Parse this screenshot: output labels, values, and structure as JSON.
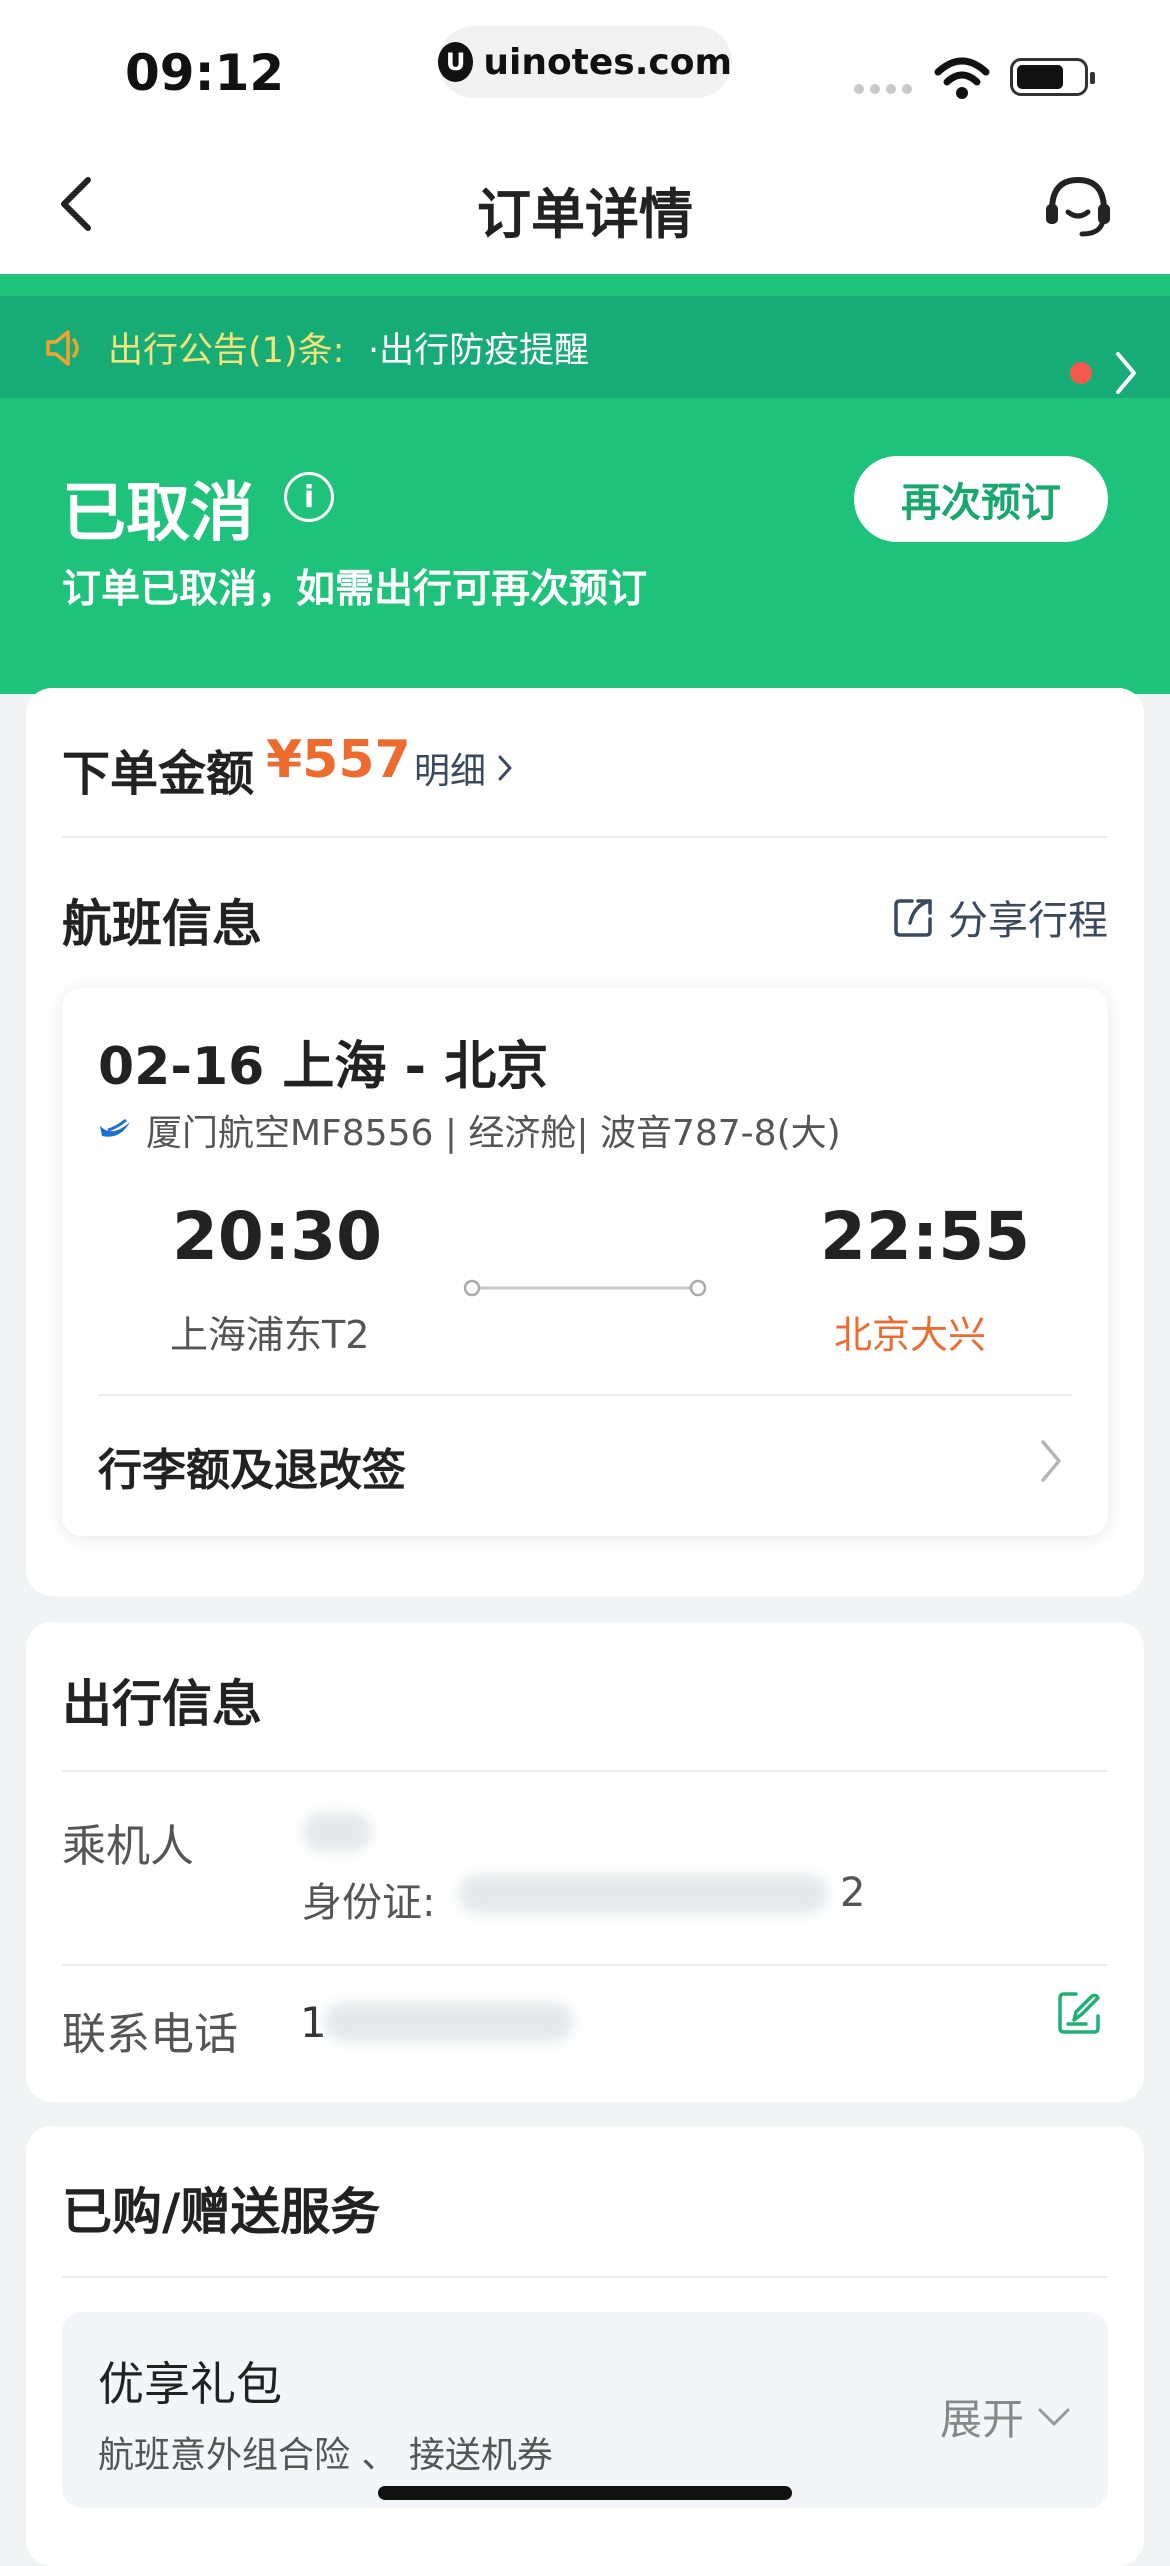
{
  "status_bar": {
    "time": "09:12",
    "url": "uinotes.com",
    "logo_letter": "U"
  },
  "nav": {
    "title": "订单详情"
  },
  "notice": {
    "label": "出行公告(1)条:",
    "text": "·出行防疫提醒"
  },
  "order_status": {
    "title": "已取消",
    "subtitle": "订单已取消，如需出行可再次预订",
    "rebook_label": "再次预订",
    "info_icon": "i"
  },
  "order": {
    "amount_label": "下单金额",
    "amount": "¥557",
    "detail_link": "明细"
  },
  "flight": {
    "section_title": "航班信息",
    "share_label": "分享行程",
    "route": "02-16 上海 - 北京",
    "airline_info": "厦门航空MF8556 | 经济舱| 波音787-8(大)",
    "dep_time": "20:30",
    "dep_airport": "上海浦东T2",
    "arr_time": "22:55",
    "arr_airport": "北京大兴",
    "baggage_label": "行李额及退改签"
  },
  "travel": {
    "section_title": "出行信息",
    "passenger_label": "乘机人",
    "id_label": "身份证:",
    "id_tail": "2",
    "phone_label": "联系电话",
    "phone_start": "1"
  },
  "services": {
    "section_title": "已购/赠送服务",
    "gift_title": "优享礼包",
    "gift_sub": "航班意外组合险 、 接送机券",
    "expand_label": "展开"
  },
  "colors": {
    "brand_green": "#1fc27a",
    "notice_bg": "#17ab76",
    "accent_orange": "#ee6b2f"
  }
}
